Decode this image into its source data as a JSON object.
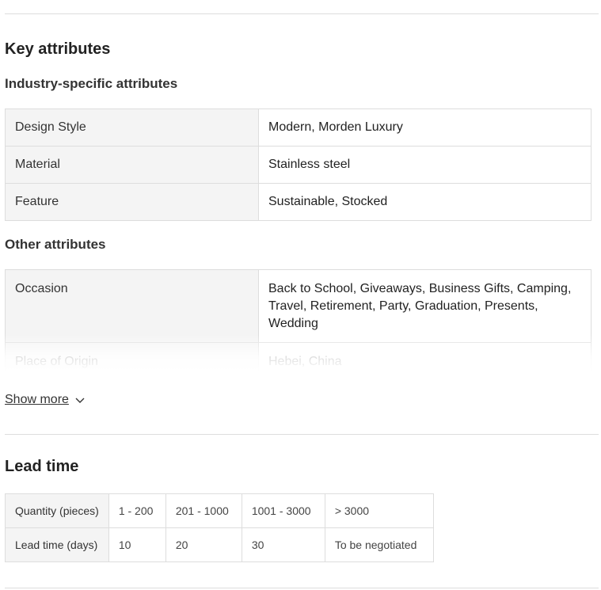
{
  "key_attributes": {
    "title": "Key attributes",
    "industry": {
      "title": "Industry-specific attributes",
      "rows": [
        {
          "key": "Design Style",
          "value": "Modern, Morden Luxury"
        },
        {
          "key": "Material",
          "value": "Stainless steel"
        },
        {
          "key": "Feature",
          "value": "Sustainable, Stocked"
        }
      ]
    },
    "other": {
      "title": "Other attributes",
      "rows": [
        {
          "key": "Occasion",
          "value": "Back to School, Giveaways, Business Gifts, Camping, Travel, Retirement, Party, Graduation, Presents, Wedding"
        },
        {
          "key": "Place of Origin",
          "value": "Hebei, China"
        }
      ]
    },
    "show_more": "Show more"
  },
  "lead_time": {
    "title": "Lead time",
    "header": [
      "Quantity (pieces)",
      "1 - 200",
      "201 - 1000",
      "1001 - 3000",
      "> 3000"
    ],
    "row": [
      "Lead time (days)",
      "10",
      "20",
      "30",
      "To be negotiated"
    ]
  },
  "icons": {
    "show_more": "chevron-down-icon"
  },
  "colors": {
    "divider": "#dddddd",
    "key_cell_bg": "#f4f4f4"
  }
}
